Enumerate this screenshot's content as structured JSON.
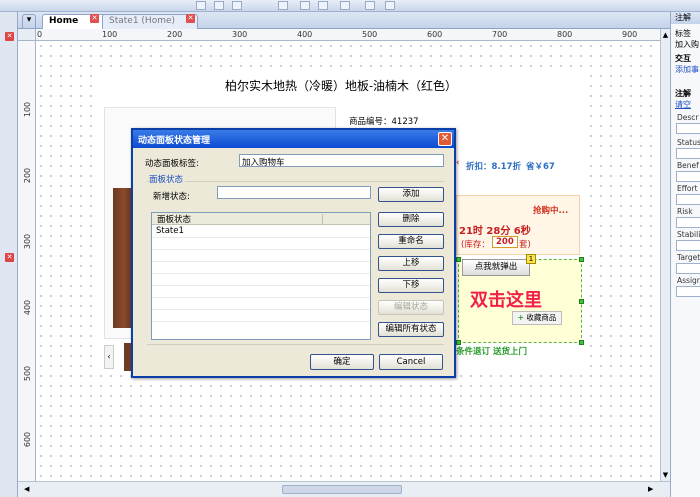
{
  "tabs": {
    "home": "Home",
    "state1": "State1 (Home)"
  },
  "ruler": {
    "h_ticks": [
      "0",
      "100",
      "200",
      "300",
      "400",
      "500",
      "600",
      "700",
      "800",
      "900"
    ],
    "v_ticks": [
      "100",
      "200",
      "300",
      "400",
      "500",
      "600"
    ]
  },
  "product": {
    "title": "柏尔实木地热（冷暖）地板-油楠木（红色）",
    "code": "商品编号：41237",
    "discount": "折扣：8.17折",
    "save": "省￥67",
    "rush": "抢购中...",
    "countdown": "21时 28分 6秒",
    "stock_label": "(库存：",
    "stock_value": "200",
    "stock_unit": "套)",
    "popup_button": "点我就弹出",
    "badge": "1",
    "double_click_hint": "双击这里",
    "favorite": "收藏商品",
    "service": "条件退订  送货上门"
  },
  "dialog": {
    "title": "动态面板状态管理",
    "panel_label_caption": "动态面板标签:",
    "panel_label_value": "加入购物车",
    "group_caption": "面板状态",
    "new_state_caption": "新增状态:",
    "new_state_value": "",
    "list_header": "面板状态",
    "states": [
      "State1"
    ],
    "buttons": {
      "add": "添加",
      "delete": "删除",
      "rename": "重命名",
      "up": "上移",
      "down": "下移",
      "edit_state": "编辑状态",
      "edit_all": "编辑所有状态"
    },
    "ok": "确定",
    "cancel": "Cancel"
  },
  "right_panel": {
    "header": "注解",
    "label": "标签",
    "label_value": "加入购",
    "interaction": "交互",
    "add_case": "添加事",
    "notes": "注解",
    "clear": "请空",
    "fields": [
      "Descr",
      "Status",
      "Benef",
      "Effort",
      "Risk",
      "Stabili",
      "Target",
      "Assign"
    ]
  },
  "colors": {
    "accent": "#0b4ad1",
    "highlight": "#f0204a",
    "selection": "#5bb34a"
  }
}
